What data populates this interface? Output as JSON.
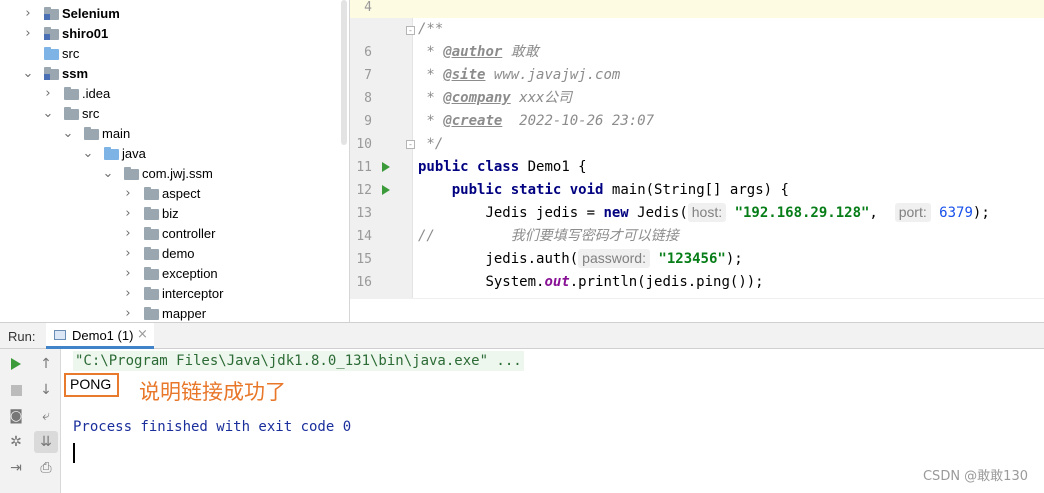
{
  "project_tree": {
    "items": [
      {
        "label": "Selenium",
        "bold": true,
        "expanded": false
      },
      {
        "label": "shiro01",
        "bold": true,
        "expanded": false
      },
      {
        "label": "src",
        "bold": false,
        "expanded": null
      },
      {
        "label": "ssm",
        "bold": true,
        "expanded": true
      },
      {
        "label": ".idea",
        "bold": false,
        "expanded": false
      },
      {
        "label": "src",
        "bold": false,
        "expanded": true
      },
      {
        "label": "main",
        "bold": false,
        "expanded": true
      },
      {
        "label": "java",
        "bold": false,
        "expanded": true
      },
      {
        "label": "com.jwj.ssm",
        "bold": false,
        "expanded": true
      },
      {
        "label": "aspect",
        "bold": false,
        "expanded": false
      },
      {
        "label": "biz",
        "bold": false,
        "expanded": false
      },
      {
        "label": "controller",
        "bold": false,
        "expanded": false
      },
      {
        "label": "demo",
        "bold": false,
        "expanded": false
      },
      {
        "label": "exception",
        "bold": false,
        "expanded": false
      },
      {
        "label": "interceptor",
        "bold": false,
        "expanded": false
      },
      {
        "label": "mapper",
        "bold": false,
        "expanded": false
      }
    ]
  },
  "editor": {
    "line_numbers": [
      "4",
      "6",
      "7",
      "8",
      "9",
      "10",
      "11",
      "12",
      "13",
      "14",
      "15",
      "16"
    ],
    "code": {
      "l6_open": "/**",
      "author_tag": "@author",
      "author_val": "敢敢",
      "site_tag": "@site",
      "site_val": "www.javajwj.com",
      "company_tag": "@company",
      "company_val": "xxx公司",
      "create_tag": "@create",
      "create_val": "2022-10-26 23:07",
      "l10_close": " */",
      "kw_public": "public",
      "kw_class": "class",
      "class_name": "Demo1 {",
      "kw_static": "static",
      "kw_void": "void",
      "main_sig": "main(String[] args) {",
      "jedis_decl": "Jedis jedis = ",
      "kw_new": "new",
      "jedis_ctor": " Jedis(",
      "host_hint": "host:",
      "host_val": "\"192.168.29.128\"",
      "port_hint": "port:",
      "port_val": "6379",
      "stmt_end": ");",
      "comment_slashes": "//",
      "comment_text": "我们要填写密码才可以链接",
      "auth_call": "jedis.auth(",
      "password_hint": "password:",
      "password_val": "\"123456\"",
      "sys_prefix": "System.",
      "sys_out": "out",
      "sys_suffix": ".println(jedis.ping());"
    }
  },
  "run_panel": {
    "label": "Run:",
    "tab_label": "Demo1 (1)",
    "tab_close": "×",
    "command_line": "\"C:\\Program Files\\Java\\jdk1.8.0_131\\bin\\java.exe\" ...",
    "output": "PONG",
    "annotation": "说明链接成功了",
    "finished": "Process finished with exit code 0"
  },
  "watermark": "CSDN @敢敢130",
  "colors": {
    "accent_tab": "#4083c9",
    "annotation": "#e8772a",
    "keyword": "#000080",
    "string": "#067d17"
  }
}
